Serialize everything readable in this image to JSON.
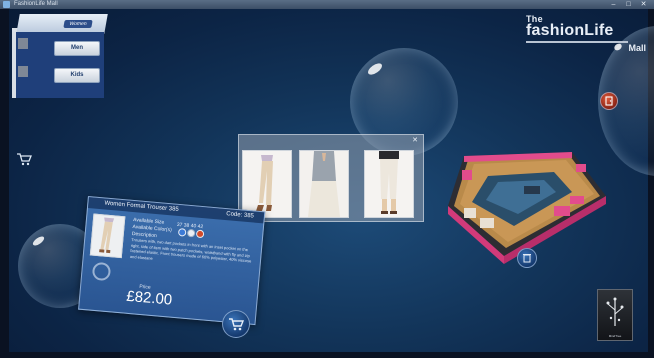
{
  "window": {
    "title": "FashionLife Mall",
    "controls": [
      "–",
      "□",
      "✕"
    ]
  },
  "brand": {
    "line1": "The",
    "line2": "fashionLife",
    "line3": "Mall"
  },
  "categories": {
    "top_label": "Women",
    "men_label": "Men",
    "kids_label": "Kids"
  },
  "gallery": {
    "close_icon": "close-icon",
    "items": [
      "trouser-side",
      "trouser-front",
      "trouser-back"
    ]
  },
  "product": {
    "name": "Women Formal Trouser 385",
    "code": "Code: 385",
    "available_size_label": "Available Size",
    "available_colors_label": "Available Color(s)",
    "description_label": "Description",
    "sizes": "37  38  40  42",
    "description_text": "Trousers with, two dart pockets in front with an inset pocket on the right, side of item with two patch pockets, waistband with fly and zip fastened elastic. Front trousers made of 60% polyester, 40% viscose and elastane",
    "price_label": "Price",
    "price": "£82.00",
    "colors": [
      "#3d7bd6",
      "#e9eef5",
      "#d24b2a"
    ]
  },
  "icons": {
    "side_cart": "cart-icon",
    "exit": "exit-door-icon",
    "trash": "trash-icon",
    "add_to_cart": "add-to-cart-icon",
    "logo": "mindtree-logo"
  },
  "logo_text": "MindTree"
}
